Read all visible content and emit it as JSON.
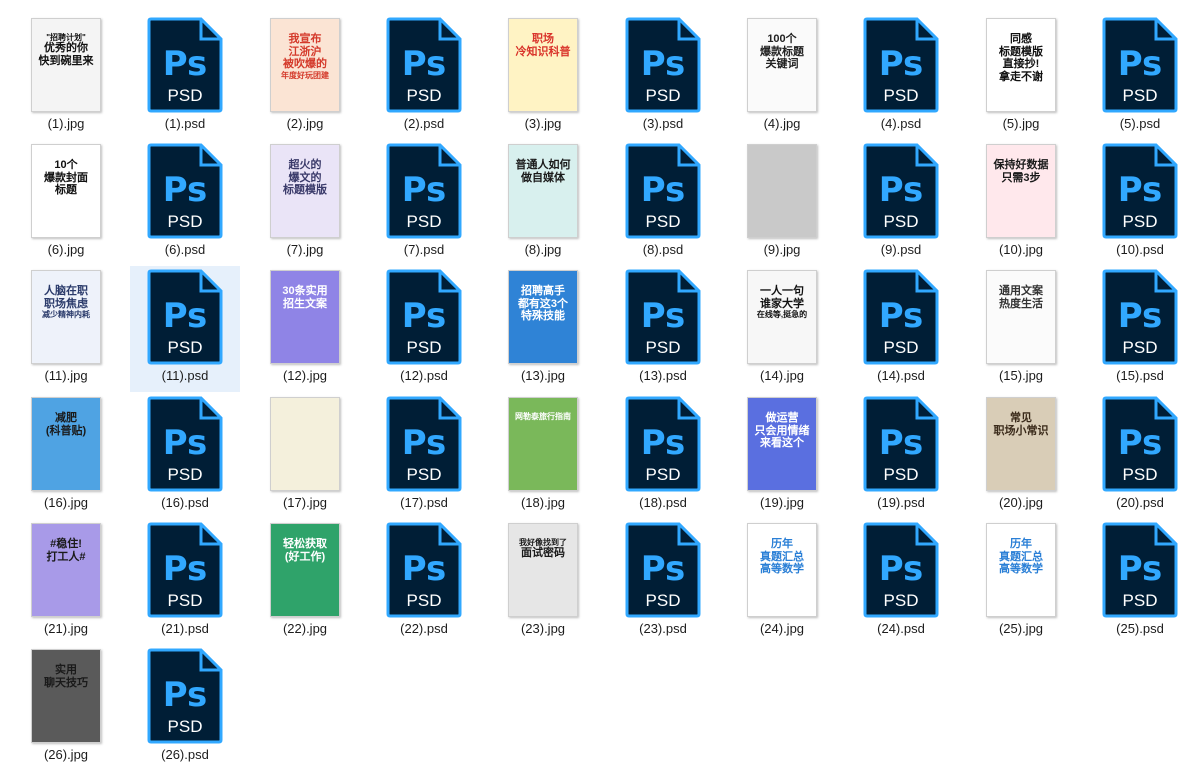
{
  "files": [
    {
      "name": "(1).jpg",
      "type": "jpg",
      "bg": "#f4f4f4",
      "fg": "#111111",
      "lines": [
        "\"招聘计划\"",
        "优秀的你",
        "快到碗里来"
      ]
    },
    {
      "name": "(1).psd",
      "type": "psd"
    },
    {
      "name": "(2).jpg",
      "type": "jpg",
      "bg": "#fbe4d4",
      "fg": "#d43a2b",
      "lines": [
        "我宣布",
        "江浙沪",
        "被吹爆的",
        "年度好玩团建"
      ]
    },
    {
      "name": "(2).psd",
      "type": "psd"
    },
    {
      "name": "(3).jpg",
      "type": "jpg",
      "bg": "#fff3c4",
      "fg": "#d9332a",
      "lines": [
        "职场",
        "冷知识科普"
      ]
    },
    {
      "name": "(3).psd",
      "type": "psd"
    },
    {
      "name": "(4).jpg",
      "type": "jpg",
      "bg": "#fafafa",
      "fg": "#222222",
      "lines": [
        "100个",
        "爆款标题",
        "关键词"
      ]
    },
    {
      "name": "(4).psd",
      "type": "psd"
    },
    {
      "name": "(5).jpg",
      "type": "jpg",
      "bg": "#ffffff",
      "fg": "#111111",
      "lines": [
        "同感",
        "标题模版",
        "直接抄!",
        "拿走不谢"
      ]
    },
    {
      "name": "(5).psd",
      "type": "psd"
    },
    {
      "name": "(6).jpg",
      "type": "jpg",
      "bg": "#ffffff",
      "fg": "#111111",
      "lines": [
        "10个",
        "爆款封面",
        "标题"
      ]
    },
    {
      "name": "(6).psd",
      "type": "psd"
    },
    {
      "name": "(7).jpg",
      "type": "jpg",
      "bg": "#eae4f7",
      "fg": "#3a3a6a",
      "lines": [
        "超火的",
        "爆文的",
        "标题模版"
      ]
    },
    {
      "name": "(7).psd",
      "type": "psd"
    },
    {
      "name": "(8).jpg",
      "type": "jpg",
      "bg": "#d8f0ee",
      "fg": "#1a1a1a",
      "lines": [
        "普通人如何",
        "做自媒体"
      ]
    },
    {
      "name": "(8).psd",
      "type": "psd"
    },
    {
      "name": "(9).jpg",
      "type": "jpg",
      "bg": "#c9c9c9",
      "fg": "#555555",
      "lines": []
    },
    {
      "name": "(9).psd",
      "type": "psd"
    },
    {
      "name": "(10).jpg",
      "type": "jpg",
      "bg": "#ffe8ec",
      "fg": "#1a1a1a",
      "lines": [
        "保持好数据",
        "只需3步"
      ]
    },
    {
      "name": "(10).psd",
      "type": "psd"
    },
    {
      "name": "(11).jpg",
      "type": "jpg",
      "bg": "#eef2fa",
      "fg": "#2a3a6a",
      "lines": [
        "人脑在职",
        "职场焦虑",
        "减少精神内耗"
      ]
    },
    {
      "name": "(11).psd",
      "type": "psd",
      "selected": true
    },
    {
      "name": "(12).jpg",
      "type": "jpg",
      "bg": "#8f84e6",
      "fg": "#ffffff",
      "lines": [
        "30条实用",
        "招生文案"
      ]
    },
    {
      "name": "(12).psd",
      "type": "psd"
    },
    {
      "name": "(13).jpg",
      "type": "jpg",
      "bg": "#2f83d6",
      "fg": "#ffffff",
      "lines": [
        "招聘高手",
        "都有这3个",
        "特殊技能"
      ]
    },
    {
      "name": "(13).psd",
      "type": "psd"
    },
    {
      "name": "(14).jpg",
      "type": "jpg",
      "bg": "#f7f7f7",
      "fg": "#111111",
      "lines": [
        "一人一句",
        "谁家大学",
        "在线等,挺急的"
      ]
    },
    {
      "name": "(14).psd",
      "type": "psd"
    },
    {
      "name": "(15).jpg",
      "type": "jpg",
      "bg": "#fbfbfb",
      "fg": "#333333",
      "lines": [
        "通用文案",
        "热度生活"
      ]
    },
    {
      "name": "(15).psd",
      "type": "psd"
    },
    {
      "name": "(16).jpg",
      "type": "jpg",
      "bg": "#4fa3e3",
      "fg": "#1a1a1a",
      "lines": [
        "减肥",
        "(科普贴)"
      ]
    },
    {
      "name": "(16).psd",
      "type": "psd"
    },
    {
      "name": "(17).jpg",
      "type": "jpg",
      "bg": "#f4f0dc",
      "fg": "#1a1a1a",
      "lines": []
    },
    {
      "name": "(17).psd",
      "type": "psd"
    },
    {
      "name": "(18).jpg",
      "type": "jpg",
      "bg": "#7ab85a",
      "fg": "#ffffff",
      "lines": [
        "网勒泰旅行指南"
      ]
    },
    {
      "name": "(18).psd",
      "type": "psd"
    },
    {
      "name": "(19).jpg",
      "type": "jpg",
      "bg": "#5a6fe0",
      "fg": "#ffffff",
      "lines": [
        "做运营",
        "只会用情绪",
        "来看这个"
      ]
    },
    {
      "name": "(19).psd",
      "type": "psd"
    },
    {
      "name": "(20).jpg",
      "type": "jpg",
      "bg": "#d9cdb7",
      "fg": "#3a2a1a",
      "lines": [
        "常见",
        "职场小常识"
      ]
    },
    {
      "name": "(20).psd",
      "type": "psd"
    },
    {
      "name": "(21).jpg",
      "type": "jpg",
      "bg": "#a89ae8",
      "fg": "#1a1a1a",
      "lines": [
        "#稳住!",
        "打工人#"
      ]
    },
    {
      "name": "(21).psd",
      "type": "psd"
    },
    {
      "name": "(22).jpg",
      "type": "jpg",
      "bg": "#2fa36a",
      "fg": "#ffffff",
      "lines": [
        "轻松获取",
        "(好工作)"
      ]
    },
    {
      "name": "(22).psd",
      "type": "psd"
    },
    {
      "name": "(23).jpg",
      "type": "jpg",
      "bg": "#e6e6e6",
      "fg": "#1a1a1a",
      "lines": [
        "我好像找到了",
        "面试密码"
      ]
    },
    {
      "name": "(23).psd",
      "type": "psd"
    },
    {
      "name": "(24).jpg",
      "type": "jpg",
      "bg": "#ffffff",
      "fg": "#2a7fd6",
      "lines": [
        "历年",
        "真题汇总",
        "高等数学"
      ]
    },
    {
      "name": "(24).psd",
      "type": "psd"
    },
    {
      "name": "(25).jpg",
      "type": "jpg",
      "bg": "#ffffff",
      "fg": "#2a7fd6",
      "lines": [
        "历年",
        "真题汇总",
        "高等数学"
      ]
    },
    {
      "name": "(25).psd",
      "type": "psd"
    },
    {
      "name": "(26).jpg",
      "type": "jpg",
      "bg": "#5a5a5a",
      "fg": "#1a1a1a",
      "lines": [
        "实用",
        "聊天技巧"
      ]
    },
    {
      "name": "(26).psd",
      "type": "psd"
    }
  ],
  "psd_icon": {
    "letters": "Ps",
    "caption": "PSD",
    "body_color": "#001e36",
    "accent_color": "#31a8ff"
  }
}
